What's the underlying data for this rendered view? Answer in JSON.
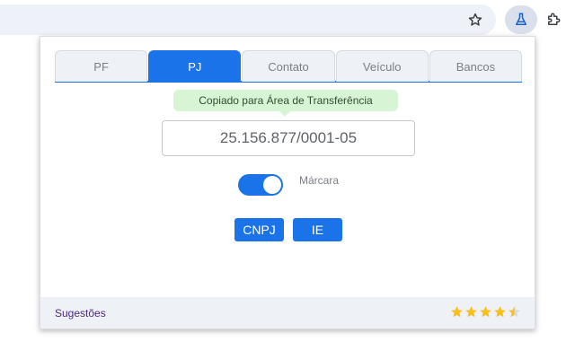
{
  "browser": {
    "icons": [
      "star-icon",
      "beaker-extension-icon",
      "puzzle-extensions-icon"
    ]
  },
  "popup": {
    "tabs": [
      {
        "label": "PF",
        "active": false
      },
      {
        "label": "PJ",
        "active": true
      },
      {
        "label": "Contato",
        "active": false
      },
      {
        "label": "Veículo",
        "active": false
      },
      {
        "label": "Bancos",
        "active": false
      }
    ],
    "tooltip": "Copiado para Área de Transferência",
    "document_value": "25.156.877/0001-05",
    "mask_toggle": {
      "label": "Márcara",
      "on": true
    },
    "buttons": {
      "cnpj": "CNPJ",
      "ie": "IE"
    },
    "footer": {
      "suggestions_label": "Sugestões",
      "rating": 4.5,
      "rating_max": 5
    }
  },
  "colors": {
    "accent": "#1a73e8",
    "tooltip_bg": "#d7f5d4",
    "star": "#f9c01a",
    "link": "#4b2a86"
  }
}
